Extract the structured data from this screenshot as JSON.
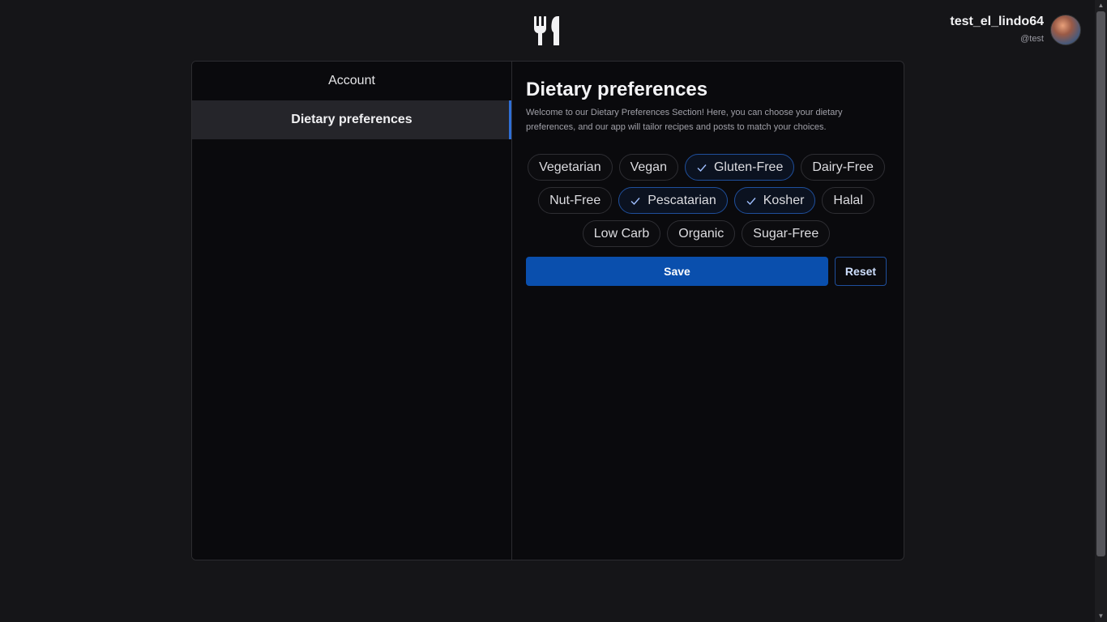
{
  "header": {
    "logo_icon": "fork-knife-icon",
    "user": {
      "name": "test_el_lindo64",
      "handle": "@test",
      "avatar_icon": "avatar-image"
    }
  },
  "sidebar": {
    "items": [
      {
        "label": "Account",
        "active": false
      },
      {
        "label": "Dietary preferences",
        "active": true
      }
    ]
  },
  "main": {
    "title": "Dietary preferences",
    "description": "Welcome to our Dietary Preferences Section! Here, you can choose your dietary preferences, and our app will tailor recipes and posts to match your choices.",
    "options": [
      {
        "label": "Vegetarian",
        "checked": false
      },
      {
        "label": "Vegan",
        "checked": false
      },
      {
        "label": "Gluten-Free",
        "checked": true
      },
      {
        "label": "Dairy-Free",
        "checked": false
      },
      {
        "label": "Nut-Free",
        "checked": false
      },
      {
        "label": "Pescatarian",
        "checked": true
      },
      {
        "label": "Kosher",
        "checked": true
      },
      {
        "label": "Halal",
        "checked": false
      },
      {
        "label": "Low Carb",
        "checked": false
      },
      {
        "label": "Organic",
        "checked": false
      },
      {
        "label": "Sugar-Free",
        "checked": false
      }
    ],
    "save_label": "Save",
    "reset_label": "Reset"
  },
  "colors": {
    "accent": "#0a4fad",
    "selected_border": "#1f4f9c",
    "background": "#151518",
    "panel": "#0a0a0d"
  }
}
